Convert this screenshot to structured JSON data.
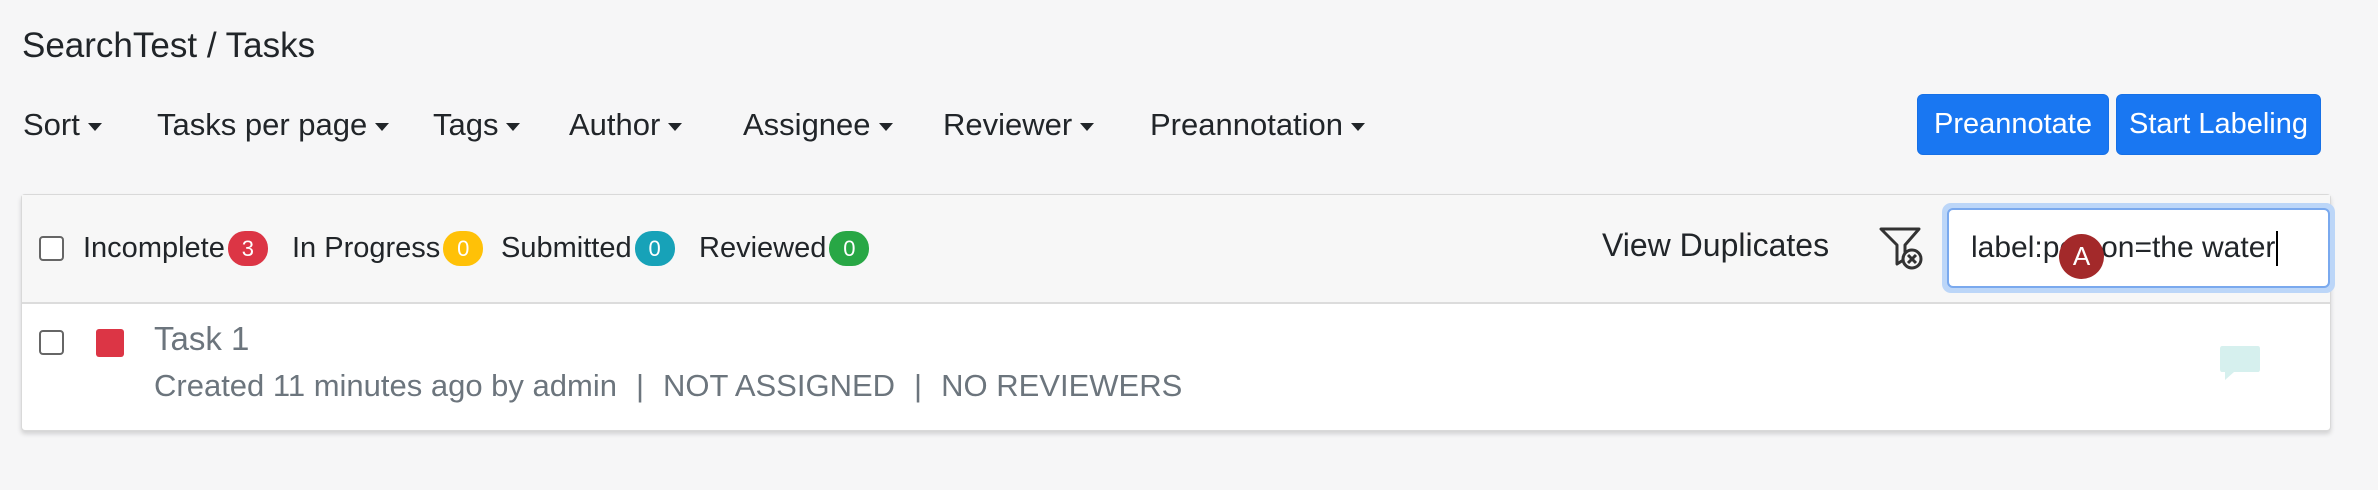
{
  "breadcrumb": {
    "project": "SearchTest",
    "separator": " / ",
    "page": "Tasks"
  },
  "toolbar": {
    "menus": [
      {
        "label": "Sort"
      },
      {
        "label": "Tasks per page"
      },
      {
        "label": "Tags"
      },
      {
        "label": "Author"
      },
      {
        "label": "Assignee"
      },
      {
        "label": "Reviewer"
      },
      {
        "label": "Preannotation"
      }
    ],
    "preannotate_label": "Preannotate",
    "start_labeling_label": "Start Labeling"
  },
  "status_filters": [
    {
      "label": "Incomplete",
      "count": "3",
      "color": "#dc3545",
      "text_color": "#ffffff"
    },
    {
      "label": "In Progress",
      "count": "0",
      "color": "#ffc107",
      "text_color": "#ffffff"
    },
    {
      "label": "Submitted",
      "count": "0",
      "color": "#17a2b8",
      "text_color": "#ffffff"
    },
    {
      "label": "Reviewed",
      "count": "0",
      "color": "#28a745",
      "text_color": "#ffffff"
    }
  ],
  "view_duplicates_label": "View Duplicates",
  "search": {
    "value": "label:person=the water"
  },
  "tasks": [
    {
      "title": "Task 1",
      "created": "Created 11 minutes ago by admin",
      "assignment": "NOT ASSIGNED",
      "reviewers": "NO REVIEWERS",
      "avatar_initial": "A",
      "status_color": "#dc3545"
    }
  ],
  "colors": {
    "primary": "#1977f2",
    "avatar": "#a3292a",
    "comment_icon": "#d6f0ee"
  }
}
